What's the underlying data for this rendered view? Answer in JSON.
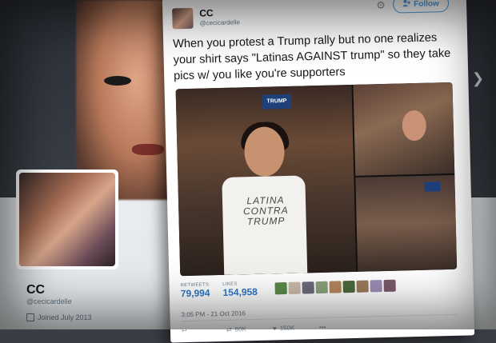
{
  "profile": {
    "name": "CC",
    "handle": "@cecicardelle",
    "joined": "Joined July 2013"
  },
  "tweet": {
    "name": "CC",
    "handle": "@cecicardelle",
    "follow_label": "Follow",
    "text": "When you protest a Trump rally but no one realizes your shirt says \"Latinas AGAINST trump\" so they take pics w/ you like you're supporters",
    "retweets_label": "RETWEETS",
    "retweets": "79,994",
    "likes_label": "LIKES",
    "likes": "154,958",
    "timestamp": "3:05 PM - 21 Oct 2016",
    "retweet_count": "80K",
    "like_count": "150K",
    "photo_sign": "TRUMP",
    "shirt_text": "LATINA CONTRA TRUMP"
  },
  "colors": {
    "accent": "#4a9be0",
    "stat_value": "#2e77c4",
    "text": "#14171a",
    "muted": "#657786"
  },
  "icons": [
    "gear-icon",
    "add-user-icon",
    "reply-icon",
    "retweet-icon",
    "heart-icon",
    "more-icon",
    "calendar-icon",
    "chevron-right-icon"
  ]
}
